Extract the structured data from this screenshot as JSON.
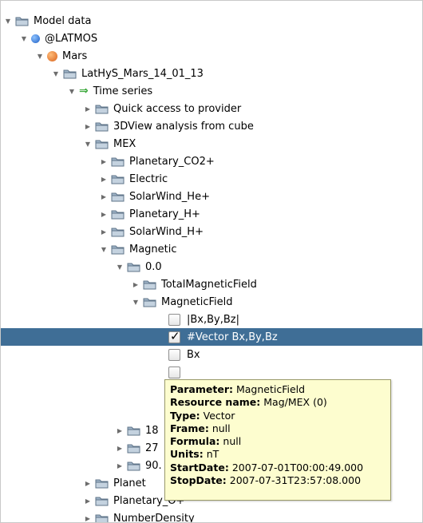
{
  "colors": {
    "selection": "#3f6e96",
    "tooltip_bg": "#fdfdcf",
    "folder": "#8aa3bb",
    "mars": "#e87822",
    "latmos": "#2a6fd6",
    "timeseries_arrow": "#3aa83a"
  },
  "tree": {
    "model_data": "Model data",
    "latmos": "@LATMOS",
    "mars": "Mars",
    "lathys": "LatHyS_Mars_14_01_13",
    "time_series": "Time series",
    "quick_access": "Quick access to provider",
    "view3d": "3DView analysis from cube",
    "mex": "MEX",
    "planetary_co2": "Planetary_CO2+",
    "electric": "Electric",
    "solarwind_he": "SolarWind_He+",
    "planetary_h": "Planetary_H+",
    "solarwind_h": "SolarWind_H+",
    "magnetic": "Magnetic",
    "zero": "0.0",
    "total_magnetic_field": "TotalMagneticField",
    "magnetic_field": "MagneticField",
    "abs_b": "|Bx,By,Bz|",
    "vector_b": "#Vector Bx,By,Bz",
    "bx": "Bx",
    "f180": "18",
    "f270": "27",
    "f90": "90.",
    "planet_a": "Planet",
    "planetary_o": "Planetary_O+",
    "number_density": "NumberDensity"
  },
  "tooltip": {
    "parameter_label": "Parameter:",
    "parameter_value": "MagneticField",
    "resource_label": "Resource name:",
    "resource_value": "Mag/MEX (0)",
    "type_label": "Type:",
    "type_value": "Vector",
    "frame_label": "Frame:",
    "frame_value": "null",
    "formula_label": "Formula:",
    "formula_value": "null",
    "units_label": "Units:",
    "units_value": "nT",
    "start_label": "StartDate:",
    "start_value": "2007-07-01T00:00:49.000",
    "stop_label": "StopDate:",
    "stop_value": "2007-07-31T23:57:08.000"
  }
}
